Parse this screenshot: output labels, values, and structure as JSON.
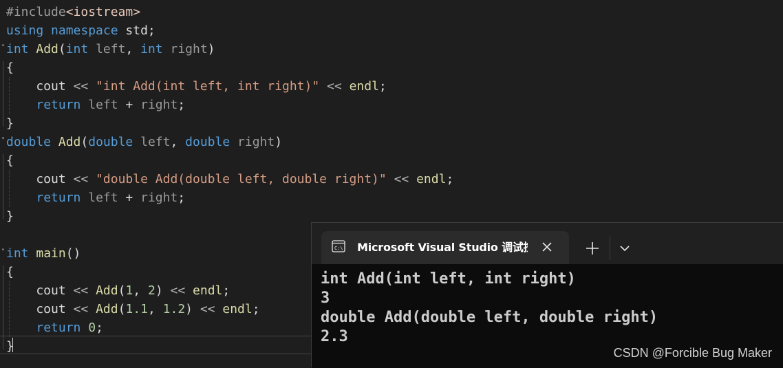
{
  "editor": {
    "lines": [
      [
        {
          "t": "#include",
          "c": "pre"
        },
        {
          "t": "<iostream>",
          "c": "inc"
        }
      ],
      [
        {
          "t": "using",
          "c": "kw"
        },
        {
          "t": " ",
          "c": "plain"
        },
        {
          "t": "namespace",
          "c": "kw"
        },
        {
          "t": " std;",
          "c": "plain"
        }
      ],
      [
        {
          "t": "int",
          "c": "kw"
        },
        {
          "t": " ",
          "c": "plain"
        },
        {
          "t": "Add",
          "c": "fn def"
        },
        {
          "t": "(",
          "c": "plain"
        },
        {
          "t": "int",
          "c": "kw"
        },
        {
          "t": " ",
          "c": "plain"
        },
        {
          "t": "left",
          "c": "param"
        },
        {
          "t": ", ",
          "c": "plain"
        },
        {
          "t": "int",
          "c": "kw"
        },
        {
          "t": " ",
          "c": "plain"
        },
        {
          "t": "right",
          "c": "param"
        },
        {
          "t": ")",
          "c": "plain"
        }
      ],
      [
        {
          "t": "{",
          "c": "plain"
        }
      ],
      [
        {
          "t": "    cout ",
          "c": "plain"
        },
        {
          "t": "<<",
          "c": "punc"
        },
        {
          "t": " ",
          "c": "plain"
        },
        {
          "t": "\"int Add(int left, int right)\"",
          "c": "str"
        },
        {
          "t": " ",
          "c": "plain"
        },
        {
          "t": "<<",
          "c": "punc"
        },
        {
          "t": " ",
          "c": "plain"
        },
        {
          "t": "endl",
          "c": "fn"
        },
        {
          "t": ";",
          "c": "plain"
        }
      ],
      [
        {
          "t": "    ",
          "c": "plain"
        },
        {
          "t": "return",
          "c": "kw"
        },
        {
          "t": " ",
          "c": "plain"
        },
        {
          "t": "left",
          "c": "param"
        },
        {
          "t": " + ",
          "c": "plain"
        },
        {
          "t": "right",
          "c": "param"
        },
        {
          "t": ";",
          "c": "plain"
        }
      ],
      [
        {
          "t": "}",
          "c": "plain"
        }
      ],
      [
        {
          "t": "double",
          "c": "kw"
        },
        {
          "t": " ",
          "c": "plain"
        },
        {
          "t": "Add",
          "c": "fn def"
        },
        {
          "t": "(",
          "c": "plain"
        },
        {
          "t": "double",
          "c": "kw"
        },
        {
          "t": " ",
          "c": "plain"
        },
        {
          "t": "left",
          "c": "param"
        },
        {
          "t": ", ",
          "c": "plain"
        },
        {
          "t": "double",
          "c": "kw"
        },
        {
          "t": " ",
          "c": "plain"
        },
        {
          "t": "right",
          "c": "param"
        },
        {
          "t": ")",
          "c": "plain"
        }
      ],
      [
        {
          "t": "{",
          "c": "plain"
        }
      ],
      [
        {
          "t": "    cout ",
          "c": "plain"
        },
        {
          "t": "<<",
          "c": "punc"
        },
        {
          "t": " ",
          "c": "plain"
        },
        {
          "t": "\"double Add(double left, double right)\"",
          "c": "str"
        },
        {
          "t": " ",
          "c": "plain"
        },
        {
          "t": "<<",
          "c": "punc"
        },
        {
          "t": " ",
          "c": "plain"
        },
        {
          "t": "endl",
          "c": "fn"
        },
        {
          "t": ";",
          "c": "plain"
        }
      ],
      [
        {
          "t": "    ",
          "c": "plain"
        },
        {
          "t": "return",
          "c": "kw"
        },
        {
          "t": " ",
          "c": "plain"
        },
        {
          "t": "left",
          "c": "param"
        },
        {
          "t": " + ",
          "c": "plain"
        },
        {
          "t": "right",
          "c": "param"
        },
        {
          "t": ";",
          "c": "plain"
        }
      ],
      [
        {
          "t": "}",
          "c": "plain"
        }
      ],
      [],
      [
        {
          "t": "int",
          "c": "kw"
        },
        {
          "t": " ",
          "c": "plain"
        },
        {
          "t": "main",
          "c": "fn"
        },
        {
          "t": "()",
          "c": "plain"
        }
      ],
      [
        {
          "t": "{",
          "c": "plain"
        }
      ],
      [
        {
          "t": "    cout ",
          "c": "plain"
        },
        {
          "t": "<<",
          "c": "punc"
        },
        {
          "t": " ",
          "c": "plain"
        },
        {
          "t": "Add",
          "c": "fn"
        },
        {
          "t": "(",
          "c": "plain"
        },
        {
          "t": "1",
          "c": "num"
        },
        {
          "t": ", ",
          "c": "plain"
        },
        {
          "t": "2",
          "c": "num"
        },
        {
          "t": ") ",
          "c": "plain"
        },
        {
          "t": "<<",
          "c": "punc"
        },
        {
          "t": " ",
          "c": "plain"
        },
        {
          "t": "endl",
          "c": "fn"
        },
        {
          "t": ";",
          "c": "plain"
        }
      ],
      [
        {
          "t": "    cout ",
          "c": "plain"
        },
        {
          "t": "<<",
          "c": "punc"
        },
        {
          "t": " ",
          "c": "plain"
        },
        {
          "t": "Add",
          "c": "fn"
        },
        {
          "t": "(",
          "c": "plain"
        },
        {
          "t": "1.1",
          "c": "num"
        },
        {
          "t": ", ",
          "c": "plain"
        },
        {
          "t": "1.2",
          "c": "num"
        },
        {
          "t": ") ",
          "c": "plain"
        },
        {
          "t": "<<",
          "c": "punc"
        },
        {
          "t": " ",
          "c": "plain"
        },
        {
          "t": "endl",
          "c": "fn"
        },
        {
          "t": ";",
          "c": "plain"
        }
      ],
      [
        {
          "t": "    ",
          "c": "plain"
        },
        {
          "t": "return",
          "c": "kw"
        },
        {
          "t": " ",
          "c": "plain"
        },
        {
          "t": "0",
          "c": "num"
        },
        {
          "t": ";",
          "c": "plain"
        }
      ],
      [
        {
          "t": "}",
          "c": "plain"
        }
      ]
    ],
    "fold_lines": [
      2,
      7,
      13
    ],
    "colors": {
      "background": "#1e1e1e",
      "keyword": "#569cd6",
      "function": "#dcdcaa",
      "string": "#d69d85",
      "number": "#b5cea8",
      "text": "#dcdcdc"
    }
  },
  "terminal": {
    "tab_title": "Microsoft Visual Studio 调试控制台",
    "tab_icon": "console-app-icon",
    "close_icon": "close-icon",
    "new_tab_icon": "plus-icon",
    "dropdown_icon": "chevron-down-icon",
    "output": [
      "int Add(int left, int right)",
      "3",
      "double Add(double left, double right)",
      "2.3"
    ],
    "colors": {
      "background": "#0c0c0c",
      "tab_strip": "#202020",
      "active_tab": "#2b2b2b",
      "text": "#cccccc"
    }
  },
  "watermark": "CSDN @Forcible Bug Maker"
}
